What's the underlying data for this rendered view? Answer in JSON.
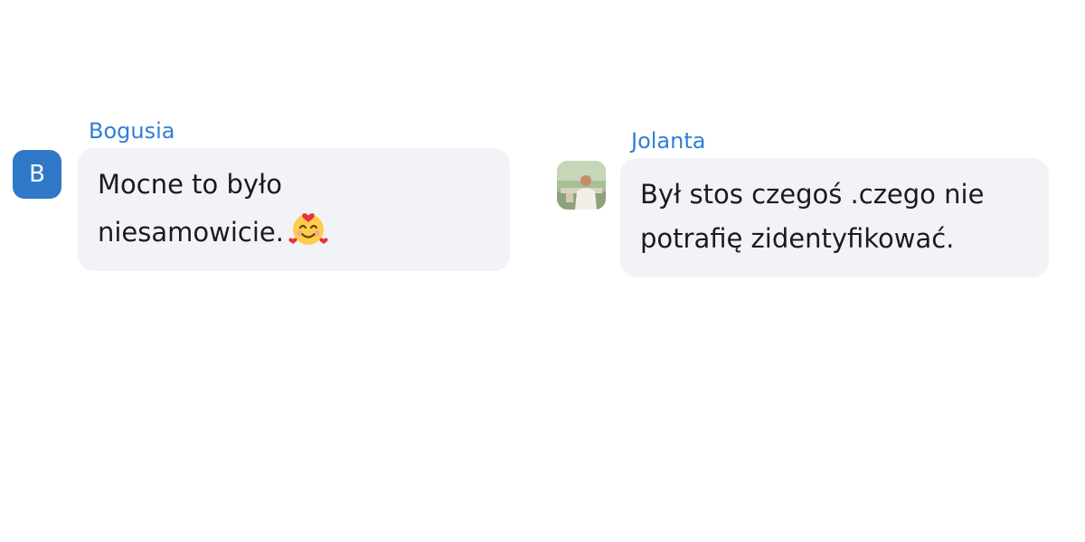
{
  "comments": [
    {
      "author": "Bogusia",
      "avatar_initial": "B",
      "avatar_color": "#2f78c8",
      "lines": [
        "Mocne to było",
        "niesamowicie."
      ],
      "emoji": "smiling-face-with-hearts-icon"
    },
    {
      "author": "Jolanta",
      "avatar_type": "photo",
      "lines": [
        "Był stos czegoś .czego nie",
        "potrafię zidentyfikować."
      ]
    }
  ],
  "colors": {
    "author_name": "#2f7fd6",
    "bubble_background": "#f1f3f7",
    "text": "#1b1b1b"
  }
}
